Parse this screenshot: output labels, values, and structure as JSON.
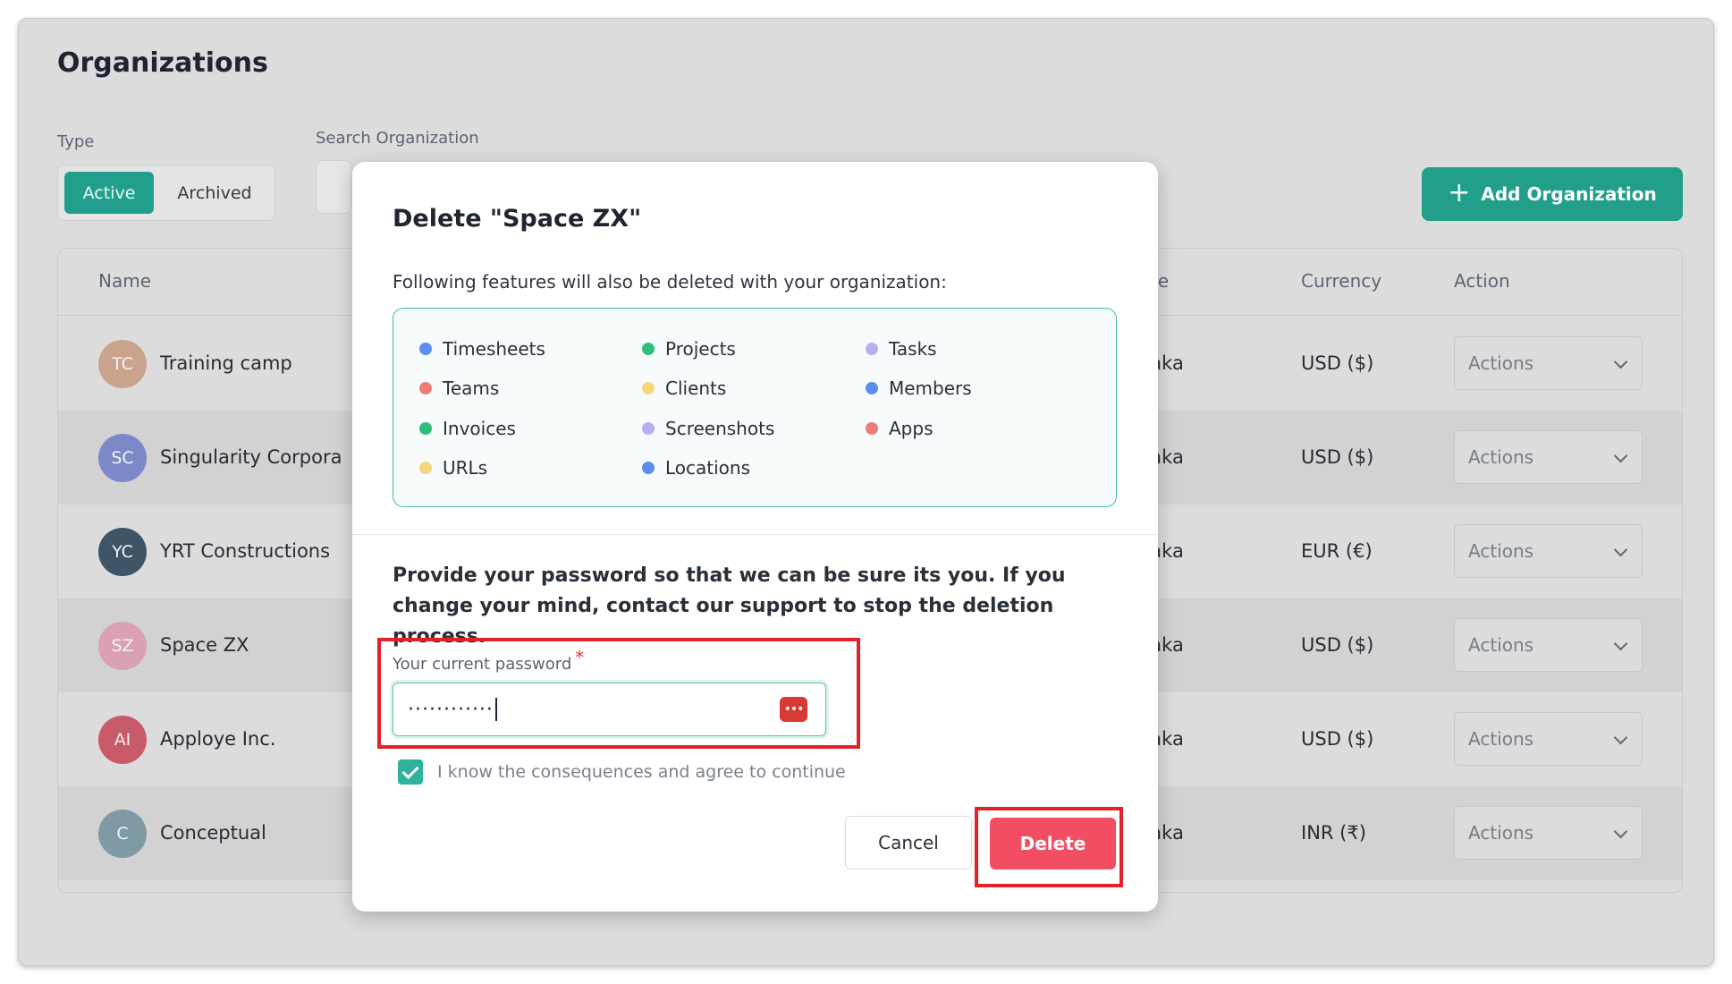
{
  "page": {
    "title": "Organizations",
    "type_label": "Type",
    "type_options": [
      "Active",
      "Archived"
    ],
    "search_label": "Search Organization",
    "add_button_label": "Add Organization"
  },
  "table": {
    "headers": {
      "name": "Name",
      "phone": "one",
      "currency": "Currency",
      "action": "Action"
    },
    "rows": [
      {
        "initials": "TC",
        "name": "Training camp",
        "phone": "haka",
        "currency": "USD ($)",
        "action": "Actions",
        "avatar_color": "#c9a38c"
      },
      {
        "initials": "SC",
        "name": "Singularity Corpora",
        "phone": "haka",
        "currency": "USD ($)",
        "action": "Actions",
        "avatar_color": "#7d88c9"
      },
      {
        "initials": "YC",
        "name": "YRT Constructions",
        "phone": "haka",
        "currency": "EUR (€)",
        "action": "Actions",
        "avatar_color": "#3e5567"
      },
      {
        "initials": "SZ",
        "name": "Space ZX",
        "phone": "haka",
        "currency": "USD ($)",
        "action": "Actions",
        "avatar_color": "#d9a1b2"
      },
      {
        "initials": "AI",
        "name": "Apploye Inc.",
        "phone": "haka",
        "currency": "USD ($)",
        "action": "Actions",
        "avatar_color": "#c95a6a"
      },
      {
        "initials": "C",
        "name": "Conceptual",
        "phone": "haka",
        "currency": "INR (₹)",
        "action": "Actions",
        "avatar_color": "#7e9aa5"
      }
    ]
  },
  "modal": {
    "title": "Delete \"Space ZX\"",
    "subtitle": "Following features will also be deleted with your organization:",
    "features": [
      {
        "label": "Timesheets",
        "color": "#5b8ef0"
      },
      {
        "label": "Projects",
        "color": "#2ebf7a"
      },
      {
        "label": "Tasks",
        "color": "#b6b0f3"
      },
      {
        "label": "Teams",
        "color": "#f07b7b"
      },
      {
        "label": "Clients",
        "color": "#f3d77c"
      },
      {
        "label": "Members",
        "color": "#5b8ef0"
      },
      {
        "label": "Invoices",
        "color": "#2ebf7a"
      },
      {
        "label": "Screenshots",
        "color": "#b6b0f3"
      },
      {
        "label": "Apps",
        "color": "#f07b7b"
      },
      {
        "label": "URLs",
        "color": "#f3d77c"
      },
      {
        "label": "Locations",
        "color": "#5b8ef0"
      }
    ],
    "warning": "Provide your password so that we can be sure its you. If you change your mind, contact our support to stop the deletion process.",
    "password_label": "Your current password",
    "required_mark": "*",
    "password_value": "············",
    "password_manager_icon": "•••",
    "agree_label": "I know the consequences and agree to continue",
    "agree_checked": true,
    "cancel_label": "Cancel",
    "delete_label": "Delete"
  }
}
